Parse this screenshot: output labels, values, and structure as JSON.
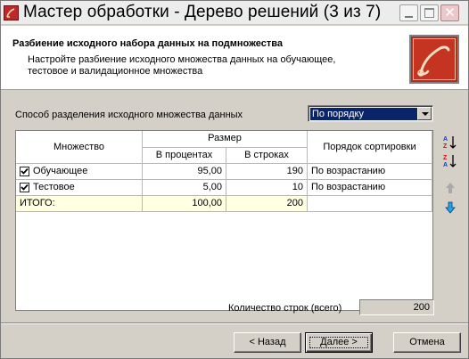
{
  "window": {
    "title": "Мастер обработки - Дерево решений (3 из 7)"
  },
  "header": {
    "title": "Разбиение исходного набора данных на подмножества",
    "description": "Настройте разбиение исходного множества данных на обучающее, тестовое и валидационное множества"
  },
  "split": {
    "label": "Способ разделения исходного множества данных",
    "selected": "По порядку"
  },
  "grid": {
    "headers": {
      "set": "Множество",
      "size": "Размер",
      "percent": "В процентах",
      "rows": "В строках",
      "sort_order": "Порядок сортировки"
    },
    "rows": [
      {
        "checked": true,
        "name": "Обучающее",
        "percent": "95,00",
        "rows": "190",
        "sort": "По возрастанию"
      },
      {
        "checked": true,
        "name": "Тестовое",
        "percent": "5,00",
        "rows": "10",
        "sort": "По возрастанию"
      }
    ],
    "total": {
      "name": "ИТОГО:",
      "percent": "100,00",
      "rows": "200"
    }
  },
  "row_count": {
    "label": "Количество строк (всего)",
    "value": "200"
  },
  "buttons": {
    "back": "< Назад",
    "next": "Далее >",
    "cancel": "Отмена"
  },
  "icons": {
    "sort_asc": "sort-az-icon",
    "sort_desc": "sort-za-icon",
    "move_up": "arrow-up-icon",
    "move_down": "arrow-down-icon"
  },
  "colors": {
    "selection": "#0a246a",
    "total_row": "#ffffe1",
    "logo": "#b82a1c"
  }
}
